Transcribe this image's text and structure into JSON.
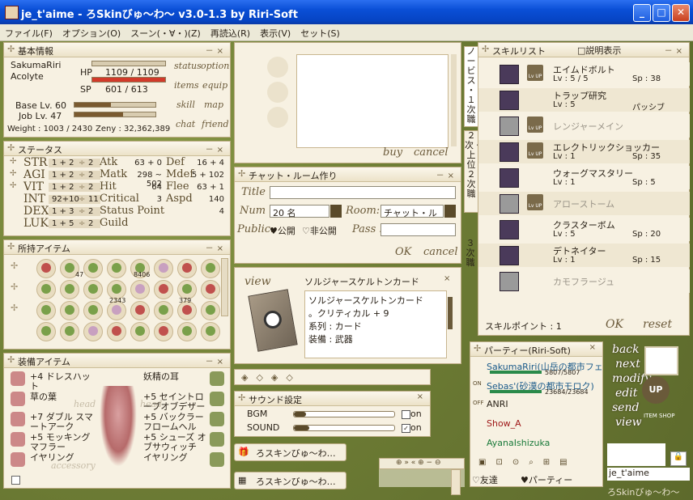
{
  "window": {
    "title": "je_t'aime - ろSkinびゅ～わ～ v3.0-1.3 by Riri-Soft"
  },
  "menu": [
    "ファイル(F)",
    "オプション(O)",
    "スーン(・∀・)(Z)",
    "再読込(R)",
    "表示(V)",
    "セット(S)"
  ],
  "basic": {
    "title": "基本情報",
    "name": "SakumaRiri",
    "job": "Acolyte",
    "hp_label": "HP",
    "hp": "1109 / 1109",
    "hp_frac": 1.0,
    "sp_label": "SP",
    "sp": "601 / 613",
    "sp_frac": 0.98,
    "base_lv": "Base Lv. 60",
    "job_lv": "Job Lv. 47",
    "base_frac": 0.45,
    "job_frac": 0.6,
    "weight": "Weight : 1003 / 2430",
    "zeny": "Zeny : 32,362,389",
    "links": [
      "status",
      "option",
      "items",
      "equip",
      "skill",
      "map",
      "chat",
      "friend"
    ]
  },
  "status": {
    "title": "ステータス",
    "stats": [
      {
        "name": "STR",
        "val": "1 + 2",
        "up": "2"
      },
      {
        "name": "AGI",
        "val": "1 + 2",
        "up": "2"
      },
      {
        "name": "VIT",
        "val": "1 + 2",
        "up": "2"
      },
      {
        "name": "INT",
        "val": "92+10",
        "up": "11"
      },
      {
        "name": "DEX",
        "val": "1 + 3",
        "up": "2"
      },
      {
        "name": "LUK",
        "val": "1 + 5",
        "up": "2"
      }
    ],
    "derived": [
      {
        "name": "Atk",
        "val": "63 + 0"
      },
      {
        "name": "Matk",
        "val": "298 ~ 502"
      },
      {
        "name": "Hit",
        "val": "64"
      },
      {
        "name": "Critical",
        "val": "3"
      },
      {
        "name": "Status Point",
        "val": ""
      },
      {
        "name": "Guild",
        "val": ""
      }
    ],
    "derived2": [
      {
        "name": "Def",
        "val": "16 + 4"
      },
      {
        "name": "Mdef",
        "val": "5 + 102"
      },
      {
        "name": "Flee",
        "val": "63 + 1"
      },
      {
        "name": "Aspd",
        "val": "140"
      },
      {
        "name": "",
        "val": "4"
      }
    ]
  },
  "inventory": {
    "title": "所持アイテム",
    "counts": [
      "47",
      "8406",
      "2343",
      "379"
    ]
  },
  "equip": {
    "title": "装備アイテム",
    "left": [
      "+4 ドレスハット",
      "草の葉",
      "+7 ダブル スマートアーク",
      "+5 モッキングマフラー",
      "イヤリング"
    ],
    "right": [
      "妖精の耳",
      "+5 セイントローブオブデザー",
      "+5 バックラーフロームヘル",
      "+5 シューズ オブサウィッチ",
      "イヤリング"
    ],
    "faint": [
      "head",
      "head",
      "accessory"
    ]
  },
  "shop": {
    "buy": "buy",
    "cancel": "cancel"
  },
  "chatroom": {
    "title": "チャット・ルーム作り",
    "title_label": "Title :",
    "num_label": "Num :",
    "num_value": "20 名",
    "room_label": "Room:",
    "room_value": "チャット・ルー",
    "public_label": "Public:",
    "public_opt": "公開",
    "private_opt": "非公開",
    "pass_label": "Pass :",
    "ok": "OK",
    "cancel": "cancel"
  },
  "card": {
    "view": "view",
    "name": "ソルジャースケルトンカード",
    "desc1": "ソルジャースケルトンカード",
    "desc2": "。クリティカル + 9",
    "type": "系列 : カード",
    "equip": "装備 : 武器"
  },
  "sound": {
    "title": "サウンド設定",
    "bgm": "BGM",
    "sound": "SOUND",
    "on": "on",
    "bgm_level": 0.12,
    "sound_level": 0.15
  },
  "skins": [
    "ろスキンびゅ～わ…",
    "ろスキンびゅ～わ…"
  ],
  "skilltabs": [
    "ノービス",
    "１次職",
    "２次・上位２次職",
    "３次職"
  ],
  "skills": {
    "title": "スキルリスト",
    "desc_toggle": "説明表示",
    "items": [
      {
        "name": "エイムドボルト",
        "lv": "Lv : 5 / 5",
        "sp": "Sp : 38",
        "lvup": true,
        "enabled": true
      },
      {
        "name": "トラップ研究",
        "lv": "Lv : 5",
        "sp": "パッシブ",
        "lvup": false,
        "enabled": true
      },
      {
        "name": "レンジャーメイン",
        "lv": "",
        "sp": "",
        "lvup": true,
        "enabled": false
      },
      {
        "name": "エレクトリックショッカー",
        "lv": "Lv : 1",
        "sp": "Sp : 35",
        "lvup": true,
        "enabled": true
      },
      {
        "name": "ウォーグマスタリー",
        "lv": "Lv : 1",
        "sp": "Sp : 5",
        "lvup": false,
        "enabled": true
      },
      {
        "name": "アローストーム",
        "lv": "",
        "sp": "",
        "lvup": true,
        "enabled": false
      },
      {
        "name": "クラスターボム",
        "lv": "Lv : 5",
        "sp": "Sp : 20",
        "lvup": false,
        "enabled": true
      },
      {
        "name": "デトネイター",
        "lv": "Lv : 1",
        "sp": "Sp : 15",
        "lvup": false,
        "enabled": true
      },
      {
        "name": "カモフラージュ",
        "lv": "",
        "sp": "",
        "lvup": false,
        "enabled": false
      }
    ],
    "points": "スキルポイント : 1",
    "ok": "OK",
    "reset": "reset"
  },
  "party": {
    "title": "パーティー(Riri-Soft)",
    "members": [
      {
        "name": "SakumaRiri(山岳の都市フェ",
        "hp": "5807/5807",
        "status": ""
      },
      {
        "name": "Sebas'(砂漠の都市モロク)",
        "hp": "23684/23684",
        "status": "ON"
      },
      {
        "name": "ANRI",
        "hp": "",
        "status": "OFF"
      },
      {
        "name": "Show_A",
        "hp": "",
        "status": ""
      },
      {
        "name": "AyanaIshizuka",
        "hp": "",
        "status": ""
      }
    ],
    "friend_tab": "友達",
    "party_tab": "パーティー"
  },
  "side": {
    "buttons": [
      "back",
      "next",
      "modify",
      "edit",
      "send",
      "view"
    ],
    "up": "UP",
    "item": "ITEM",
    "shop": "SHOP"
  },
  "bottom": {
    "name": "je_t'aime",
    "skin": "ろSkinびゅ～わ～"
  }
}
